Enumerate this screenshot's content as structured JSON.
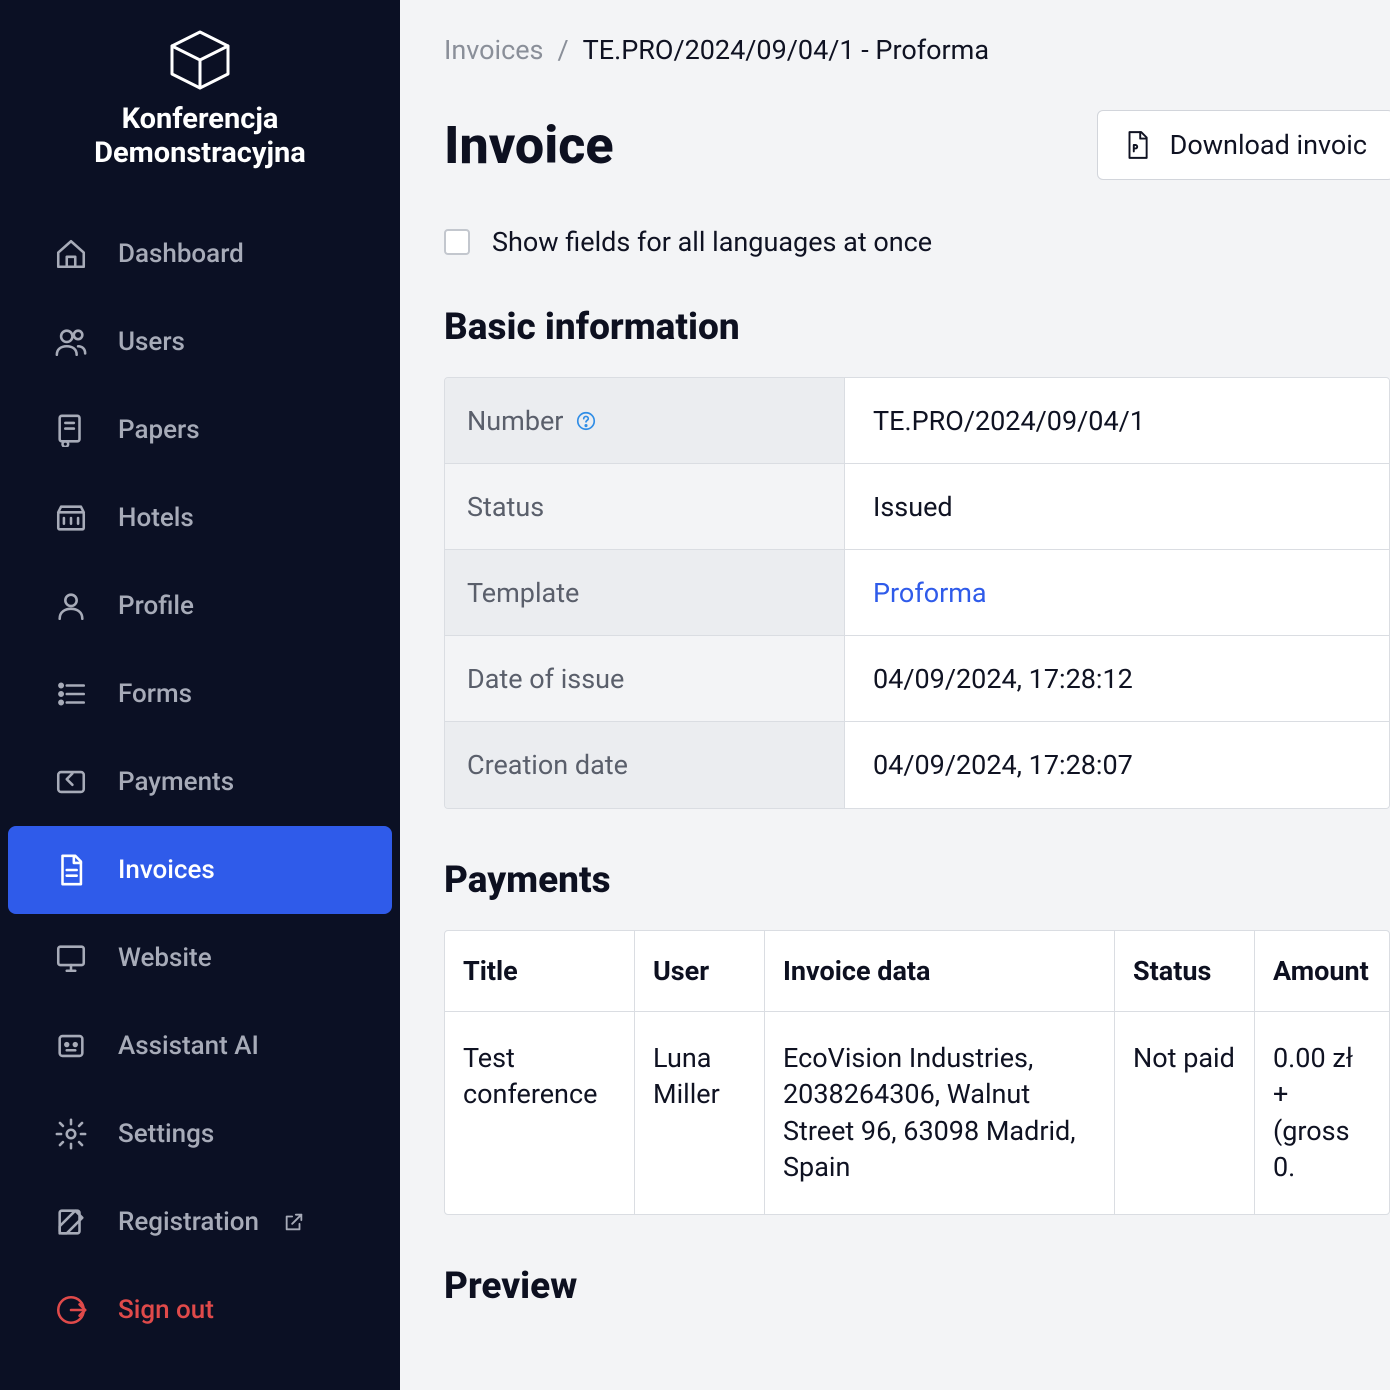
{
  "brand": {
    "title": "Konferencja Demonstracyjna"
  },
  "sidebar": {
    "items": [
      {
        "id": "dashboard",
        "label": "Dashboard",
        "icon": "home-icon",
        "active": false
      },
      {
        "id": "users",
        "label": "Users",
        "icon": "users-icon",
        "active": false
      },
      {
        "id": "papers",
        "label": "Papers",
        "icon": "papers-icon",
        "active": false
      },
      {
        "id": "hotels",
        "label": "Hotels",
        "icon": "hotels-icon",
        "active": false
      },
      {
        "id": "profile",
        "label": "Profile",
        "icon": "profile-icon",
        "active": false
      },
      {
        "id": "forms",
        "label": "Forms",
        "icon": "forms-icon",
        "active": false
      },
      {
        "id": "payments",
        "label": "Payments",
        "icon": "payments-icon",
        "active": false
      },
      {
        "id": "invoices",
        "label": "Invoices",
        "icon": "invoices-icon",
        "active": true
      },
      {
        "id": "website",
        "label": "Website",
        "icon": "website-icon",
        "active": false
      },
      {
        "id": "assistant",
        "label": "Assistant AI",
        "icon": "assistant-icon",
        "active": false
      },
      {
        "id": "settings",
        "label": "Settings",
        "icon": "settings-icon",
        "active": false
      },
      {
        "id": "registration",
        "label": "Registration",
        "icon": "registration-icon",
        "active": false,
        "external": true
      },
      {
        "id": "signout",
        "label": "Sign out",
        "icon": "signout-icon",
        "active": false,
        "signout": true
      }
    ]
  },
  "breadcrumbs": {
    "root": "Invoices",
    "current": "TE.PRO/2024/09/04/1 - Proforma"
  },
  "page": {
    "title": "Invoice",
    "download_label": "Download invoic",
    "checkbox_label": "Show fields for all languages at once"
  },
  "sections": {
    "basic": "Basic information",
    "payments": "Payments",
    "preview": "Preview"
  },
  "basic_info": {
    "number_label": "Number",
    "number_value": "TE.PRO/2024/09/04/1",
    "status_label": "Status",
    "status_value": "Issued",
    "template_label": "Template",
    "template_value": "Proforma",
    "date_issue_label": "Date of issue",
    "date_issue_value": "04/09/2024, 17:28:12",
    "creation_label": "Creation date",
    "creation_value": "04/09/2024, 17:28:07"
  },
  "payments_table": {
    "headers": {
      "title": "Title",
      "user": "User",
      "invoice_data": "Invoice data",
      "status": "Status",
      "amount": "Amount"
    },
    "rows": [
      {
        "title": "Test conference",
        "user": "Luna Miller",
        "invoice_data": "EcoVision Industries, 2038264306, Walnut Street 96, 63098 Madrid, Spain",
        "status": "Not paid",
        "amount": "0.00 zł + (gross 0."
      }
    ]
  }
}
